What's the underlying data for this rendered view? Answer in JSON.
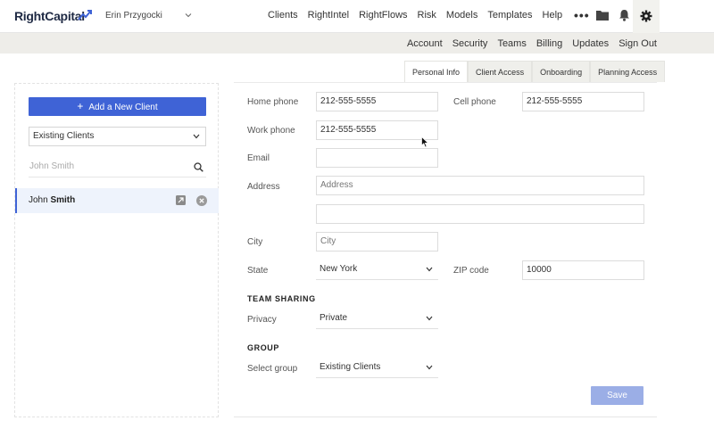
{
  "header": {
    "logo": "RightCapital",
    "user_name": "Erin Przygocki",
    "nav": [
      "Clients",
      "RightIntel",
      "RightFlows",
      "Risk",
      "Models",
      "Templates",
      "Help"
    ],
    "more": "•••"
  },
  "subnav": [
    "Account",
    "Security",
    "Teams",
    "Billing",
    "Updates",
    "Sign Out"
  ],
  "sidebar": {
    "add_button": "Add a New Client",
    "client_filter": "Existing Clients",
    "search_value": "John Smith",
    "client": {
      "first": "John",
      "last": "Smith"
    }
  },
  "tabs": [
    "Personal Info",
    "Client Access",
    "Onboarding",
    "Planning Access"
  ],
  "form": {
    "home_phone_label": "Home phone",
    "home_phone": "212-555-5555",
    "cell_phone_label": "Cell phone",
    "cell_phone": "212-555-5555",
    "work_phone_label": "Work phone",
    "work_phone": "212-555-5555",
    "email_label": "Email",
    "email": "",
    "address_label": "Address",
    "address_placeholder": "Address",
    "address2": "",
    "city_label": "City",
    "city_placeholder": "City",
    "state_label": "State",
    "state": "New York",
    "zip_label": "ZIP code",
    "zip": "10000",
    "team_sharing_title": "TEAM SHARING",
    "privacy_label": "Privacy",
    "privacy": "Private",
    "group_title": "GROUP",
    "select_group_label": "Select group",
    "select_group": "Existing Clients",
    "save_label": "Save"
  },
  "colors": {
    "primary": "#3f63d6",
    "save_disabled": "#9baee6",
    "subnav_bg": "#eeede9"
  }
}
